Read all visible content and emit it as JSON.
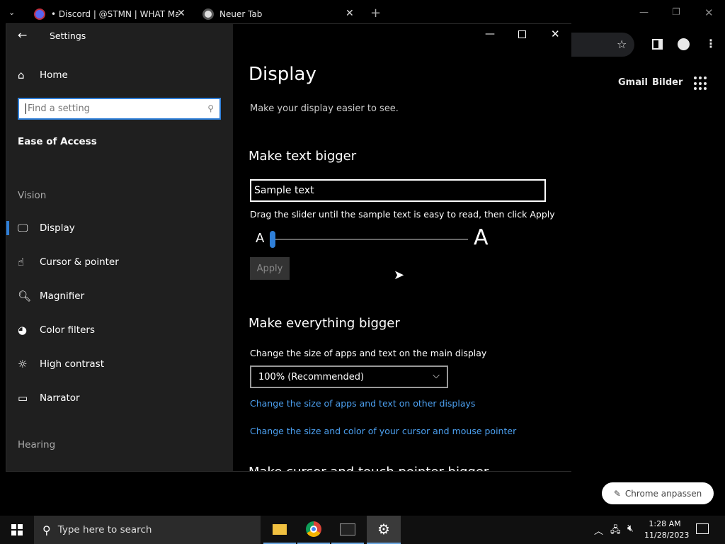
{
  "chrome": {
    "tabs": [
      {
        "title": "• Discord | @STMN | WHAT Ma"
      },
      {
        "title": "Neuer Tab"
      }
    ],
    "new_tab": "+",
    "links": {
      "gmail": "Gmail",
      "images": "Bilder"
    },
    "customize": "Chrome anpassen"
  },
  "settings": {
    "app_title": "Settings",
    "home": "Home",
    "search_placeholder": "Find a setting",
    "category": "Ease of Access",
    "vision_label": "Vision",
    "hearing_label": "Hearing",
    "nav_items": [
      {
        "label": "Display",
        "icon": "monitor-icon"
      },
      {
        "label": "Cursor & pointer",
        "icon": "cursor-icon"
      },
      {
        "label": "Magnifier",
        "icon": "magnifier-icon"
      },
      {
        "label": "Color filters",
        "icon": "color-filters-icon"
      },
      {
        "label": "High contrast",
        "icon": "high-contrast-icon"
      },
      {
        "label": "Narrator",
        "icon": "narrator-icon"
      }
    ],
    "page_title": "Display",
    "page_subtitle": "Make your display easier to see.",
    "text_section": {
      "heading": "Make text bigger",
      "sample": "Sample text",
      "instructions": "Drag the slider until the sample text is easy to read, then click Apply",
      "small_a": "A",
      "large_a": "A",
      "slider_value_percent": 100,
      "apply": "Apply"
    },
    "everything_section": {
      "heading": "Make everything bigger",
      "label": "Change the size of apps and text on the main display",
      "dropdown_value": "100% (Recommended)",
      "link1": "Change the size of apps and text on other displays",
      "link2": "Change the size and color of your cursor and mouse pointer"
    },
    "next_heading": "Make cursor and touch pointer bigger"
  },
  "taskbar": {
    "search_placeholder": "Type here to search",
    "time": "1:28 AM",
    "date": "11/28/2023"
  },
  "colors": {
    "accent": "#2f7fd8",
    "link": "#4ca0f0",
    "nav_bg": "#1f1f1f"
  }
}
